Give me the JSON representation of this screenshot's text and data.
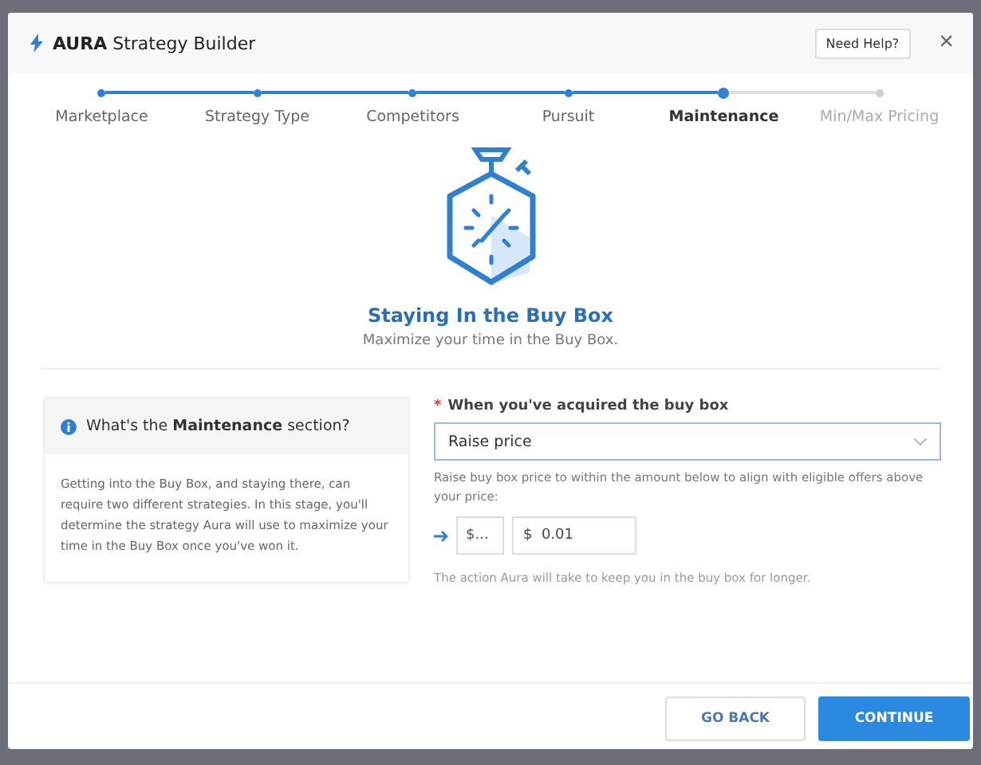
{
  "window": {
    "brand": "AURA",
    "title": "Strategy Builder",
    "help_button": "Need Help?",
    "close": "×"
  },
  "steps": [
    {
      "label": "Marketplace",
      "completed": true,
      "selected": false
    },
    {
      "label": "Strategy Type",
      "completed": true,
      "selected": false
    },
    {
      "label": "Competitors",
      "completed": true,
      "selected": false
    },
    {
      "label": "Pursuit",
      "completed": true,
      "selected": false
    },
    {
      "label": "Maintenance",
      "completed": false,
      "selected": true
    },
    {
      "label": "Min/Max Pricing",
      "completed": false,
      "selected": false
    }
  ],
  "hero": {
    "title": "Staying In the Buy Box",
    "subtitle": "Maximize your time in the Buy Box."
  },
  "info_card": {
    "title": "What's the **Maintenance** section?",
    "body": "Getting into the Buy Box, and staying there, can require two different strategies. In this stage, you'll determine the strategy Aura will use to maximize your time in the Buy Box once you've won it."
  },
  "form": {
    "required_mark": "*",
    "label": "When you've acquired the buy box",
    "select_value": "Raise price",
    "help": "Raise buy box price to within the amount below to align with eligible offers above your price:",
    "unit_select": "$...",
    "amount": "$  0.01",
    "note": "The action Aura will take to keep you in the buy box for longer."
  },
  "buttons": [
    {
      "label": "GO BACK",
      "kind": "secondary"
    },
    {
      "label": "CONTINUE",
      "kind": "primary"
    }
  ]
}
